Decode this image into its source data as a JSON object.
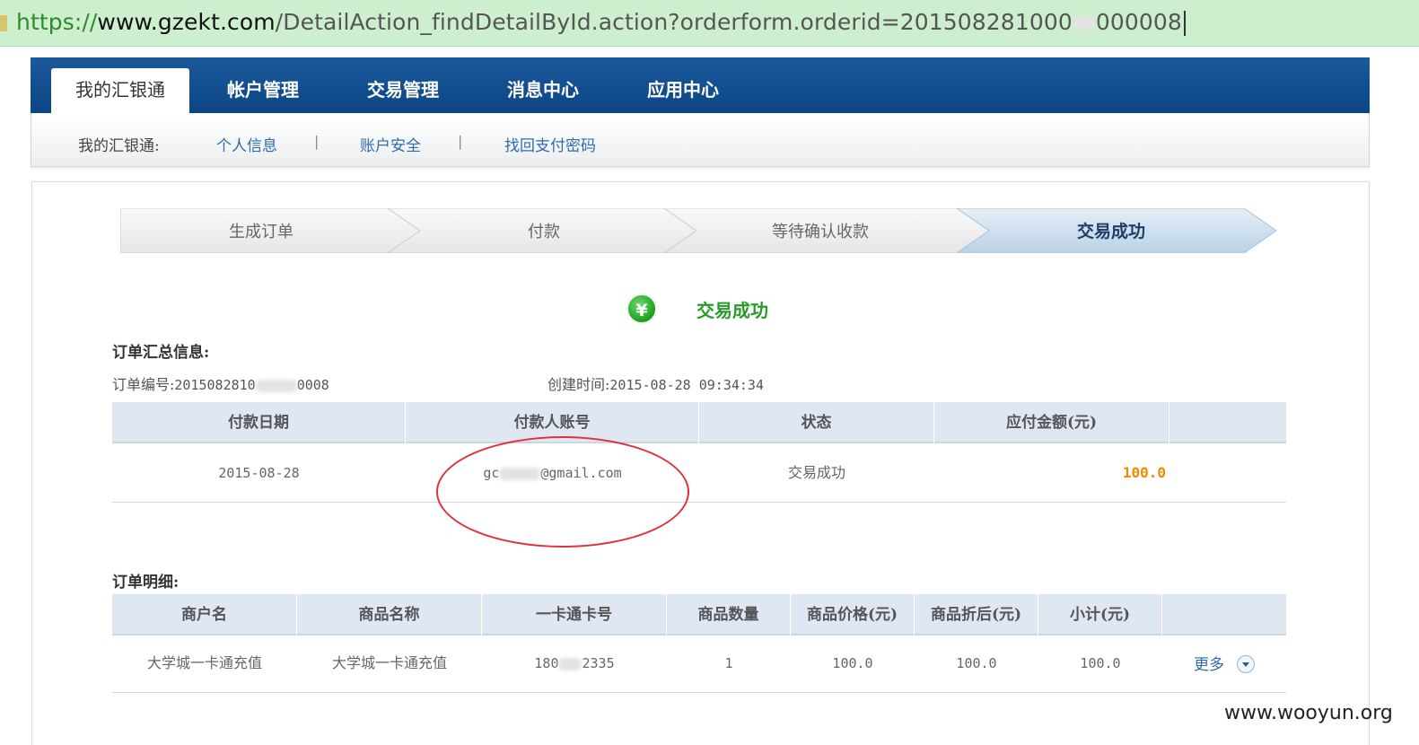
{
  "browser": {
    "url_scheme": "https://",
    "url_host": "www.gzekt.com",
    "url_rest": "/DetailAction_findDetailById.action?orderform.orderid=201508281000",
    "url_tail": "000008"
  },
  "nav": {
    "items": [
      "我的汇银通",
      "帐户管理",
      "交易管理",
      "消息中心",
      "应用中心"
    ],
    "active_index": 0
  },
  "subnav": {
    "label": "我的汇银通:",
    "links": [
      "个人信息",
      "账户安全",
      "找回支付密码"
    ],
    "separator": "|"
  },
  "steps": {
    "labels": [
      "生成订单",
      "付款",
      "等待确认收款",
      "交易成功"
    ],
    "current_index": 3
  },
  "status": {
    "icon_glyph": "¥",
    "text": "交易成功"
  },
  "summary": {
    "title": "订单汇总信息:",
    "order_no_label": "订单编号:",
    "order_no_value_a": "2015082810",
    "order_no_value_b": "0008",
    "created_label": "创建时间:",
    "created_value": "2015-08-28 09:34:34"
  },
  "payment_table": {
    "headers": [
      "付款日期",
      "付款人账号",
      "状态",
      "应付金额(元)"
    ],
    "row": {
      "date": "2015-08-28",
      "account_prefix": "gc",
      "account_suffix": "@gmail.com",
      "status": "交易成功",
      "amount": "100.0"
    }
  },
  "detail": {
    "title": "订单明细:",
    "headers": [
      "商户名",
      "商品名称",
      "一卡通卡号",
      "商品数量",
      "商品价格(元)",
      "商品折后(元)",
      "小计(元)"
    ],
    "row": {
      "merchant": "大学城一卡通充值",
      "product": "大学城一卡通充值",
      "card_prefix": "180",
      "card_suffix": "2335",
      "quantity": "1",
      "price": "100.0",
      "discounted": "100.0",
      "subtotal": "100.0"
    },
    "more_label": "更多"
  },
  "watermark": "www.wooyun.org",
  "colors": {
    "nav_blue": "#0b4585",
    "success_green": "#2a9a2a",
    "amount_orange": "#f08a00",
    "annotation_red": "#e0303a",
    "link_blue": "#2d6bb2"
  }
}
